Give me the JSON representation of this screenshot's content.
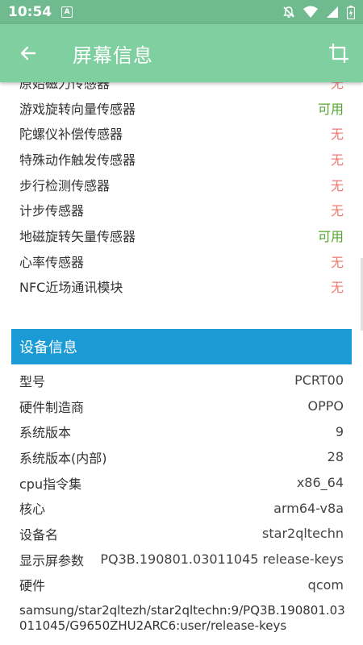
{
  "status_bar": {
    "time": "10:54",
    "badge": "A"
  },
  "app_bar": {
    "title": "屏幕信息"
  },
  "sensors": [
    {
      "label": "原始磁力传感器",
      "value": "无",
      "status": "no"
    },
    {
      "label": "游戏旋转向量传感器",
      "value": "可用",
      "status": "yes"
    },
    {
      "label": "陀螺仪补偿传感器",
      "value": "无",
      "status": "no"
    },
    {
      "label": "特殊动作触发传感器",
      "value": "无",
      "status": "no"
    },
    {
      "label": "步行检测传感器",
      "value": "无",
      "status": "no"
    },
    {
      "label": "计步传感器",
      "value": "无",
      "status": "no"
    },
    {
      "label": "地磁旋转矢量传感器",
      "value": "可用",
      "status": "yes"
    },
    {
      "label": "心率传感器",
      "value": "无",
      "status": "no"
    },
    {
      "label": "NFC近场通讯模块",
      "value": "无",
      "status": "no"
    }
  ],
  "device_section": {
    "header": "设备信息",
    "rows": [
      {
        "label": "型号",
        "value": "PCRT00"
      },
      {
        "label": "硬件制造商",
        "value": "OPPO"
      },
      {
        "label": "系统版本",
        "value": "9"
      },
      {
        "label": "系统版本(内部)",
        "value": "28"
      },
      {
        "label": "cpu指令集",
        "value": "x86_64"
      },
      {
        "label": "核心",
        "value": "arm64-v8a"
      },
      {
        "label": "设备名",
        "value": "star2qltechn"
      },
      {
        "label": "显示屏参数",
        "value": "PQ3B.190801.03011045 release-keys"
      },
      {
        "label": "硬件",
        "value": "qcom"
      }
    ],
    "fingerprint": "samsung/star2qltezh/star2qltechn:9/PQ3B.190801.03011045/G9650ZHU2ARC6:user/release-keys"
  },
  "colors": {
    "available": "#55a630",
    "unavailable": "#f07a72",
    "section_header": "#1a9bd5",
    "app_bar": "#7fcfa0"
  }
}
